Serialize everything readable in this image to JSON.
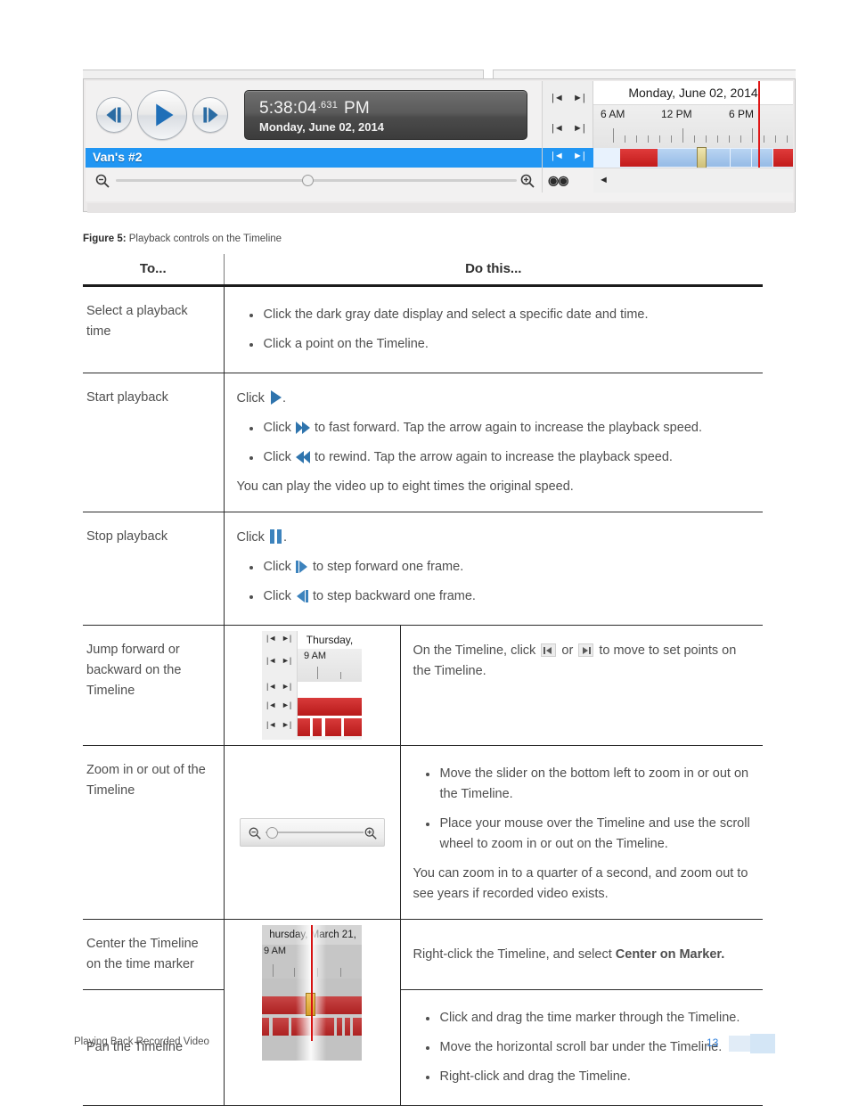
{
  "figure": {
    "player": {
      "rewind_icon": "rewind-step-icon",
      "play_icon": "play-icon",
      "forward_icon": "forward-step-icon",
      "time": "5:38:04",
      "milliseconds": ".631",
      "meridiem": "PM",
      "date": "Monday, June 02, 2014",
      "camera_name": "Van's #2",
      "zoom_out_icon": "zoom-out-magnifier-icon",
      "zoom_in_icon": "zoom-in-magnifier-icon",
      "link_icon": "link-cameras-icon"
    },
    "nav": {
      "prev_icon": "skip-previous-icon",
      "next_icon": "skip-next-icon",
      "prev_glyph": "|◄",
      "next_glyph": "►|",
      "scroll_arrow_glyph": "◄"
    },
    "timeline": {
      "date_header": "Monday, June 02, 2014",
      "tick_labels": [
        "6 AM",
        "12 PM",
        "6 PM"
      ]
    }
  },
  "caption": {
    "label": "Figure 5:",
    "text": "Playback controls on the Timeline"
  },
  "table": {
    "headers": {
      "col1": "To...",
      "col2": "Do this..."
    },
    "rows": [
      {
        "task": "Select a playback time",
        "bullets": [
          "Click the dark gray date display and select a specific date and time.",
          "Click a point on the Timeline."
        ]
      },
      {
        "task": "Start playback",
        "lead_prefix": "Click",
        "lead_suffix": ".",
        "lead_icon": "play-icon",
        "bullets": [
          {
            "prefix": "Click",
            "icon": "fast-forward-icon",
            "text": "to fast forward. Tap the arrow again to increase the playback speed."
          },
          {
            "prefix": "Click",
            "icon": "rewind-icon",
            "text": "to rewind. Tap the arrow again to increase the playback speed."
          }
        ],
        "footnote": "You can play the video up to eight times the original speed."
      },
      {
        "task": "Stop playback",
        "lead_prefix": "Click",
        "lead_suffix": ".",
        "lead_icon": "pause-icon",
        "bullets": [
          {
            "prefix": "Click",
            "icon": "step-forward-icon",
            "text": "to step forward one frame."
          },
          {
            "prefix": "Click",
            "icon": "step-backward-icon",
            "text": "to step backward one frame."
          }
        ]
      },
      {
        "task": "Jump forward or backward on the Timeline",
        "image_name": "timeline-jump-buttons-screenshot",
        "image": {
          "day_label": "Thursday,",
          "time_label": "9 AM",
          "prev_glyph": "|◄",
          "next_glyph": "►|"
        },
        "text_before": "On the Timeline, click",
        "text_between": "or",
        "text_after": "to move to set points on the Timeline."
      },
      {
        "task": "Zoom in or out of the Timeline",
        "image_name": "timeline-zoom-slider-screenshot",
        "bullets": [
          "Move the slider on the bottom left to zoom in or out on the Timeline.",
          "Place your mouse over the Timeline and use the scroll wheel to zoom in or out on the Timeline."
        ],
        "footnote": "You can zoom in to a quarter of a second, and zoom out to see years if recorded video exists."
      },
      {
        "task": "Center the Timeline on the time marker",
        "text_before": "Right-click the Timeline, and select",
        "bold_text": "Center on Marker."
      },
      {
        "task": "Pan the Timeline",
        "image_name": "timeline-pan-marker-screenshot",
        "image": {
          "day_label": "hursday, March 21,",
          "time_label": "9 AM"
        },
        "bullets": [
          "Click and drag the time marker through the Timeline.",
          "Move the horizontal scroll bar under the Timeline.",
          "Right-click and drag the Timeline."
        ]
      }
    ]
  },
  "footer": {
    "section": "Playing Back Recorded Video",
    "page_number": "13"
  }
}
